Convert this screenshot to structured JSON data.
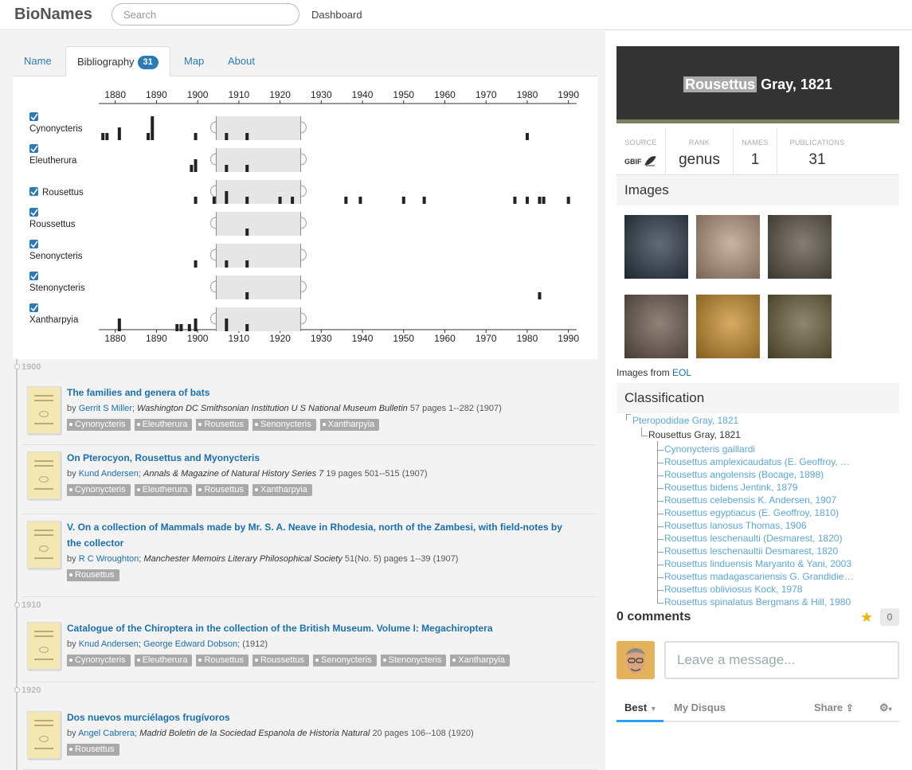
{
  "topbar": {
    "brand": "BioNames",
    "search_placeholder": "Search",
    "nav_dashboard": "Dashboard"
  },
  "tabs": [
    {
      "label": "Name"
    },
    {
      "label": "Bibliography",
      "badge": "31"
    },
    {
      "label": "Map"
    },
    {
      "label": "About"
    }
  ],
  "timeline": {
    "years": [
      "1880",
      "1890",
      "1900",
      "1910",
      "1920",
      "1930",
      "1940",
      "1950",
      "1960",
      "1970",
      "1980",
      "1990"
    ],
    "year_start": 1876,
    "year_end": 1992,
    "selection": [
      1904.5,
      1925
    ],
    "rows": [
      {
        "name": "Cynonycteris",
        "checked": true,
        "marks": [
          1877,
          1878,
          1881,
          1888,
          1889,
          1899.5,
          1907,
          1912,
          1980
        ]
      },
      {
        "name": "Eleutherura",
        "checked": true,
        "marks": [
          1898.5,
          1899.5,
          1907,
          1912
        ]
      },
      {
        "name": "Rousettus",
        "checked": true,
        "marks": [
          1899.5,
          1904,
          1907,
          1912,
          1920,
          1923,
          1936,
          1939.5,
          1950,
          1955,
          1977,
          1980,
          1983,
          1984,
          1990
        ]
      },
      {
        "name": "Roussettus",
        "checked": true,
        "marks": [
          1912
        ]
      },
      {
        "name": "Senonycteris",
        "checked": true,
        "marks": [
          1899.5,
          1907,
          1912
        ]
      },
      {
        "name": "Stenonycteris",
        "checked": true,
        "marks": [
          1912,
          1983
        ]
      },
      {
        "name": "Xantharpyia",
        "checked": true,
        "marks": [
          1881,
          1895,
          1896,
          1898,
          1899.5,
          1907,
          1912
        ]
      }
    ],
    "tall_marks": {
      "Cynonycteris": [
        1881,
        1889
      ],
      "Rousettus": [
        1907
      ],
      "Eleutherura": [
        1899.5
      ],
      "Xantharpyia": [
        1881,
        1899.5,
        1907
      ]
    }
  },
  "bibliography": {
    "decades": [
      "1900",
      "1910",
      "1920"
    ],
    "entries": [
      {
        "title": "The families and genera of bats",
        "authors": [
          "Gerrit S Miller"
        ],
        "journal": "Washington DC Smithsonian Institution U S National Museum Bulletin",
        "details": "57 pages 1--282 (1907)",
        "tags": [
          "Cynonycteris",
          "Eleutherura",
          "Rousettus",
          "Senonycteris",
          "Xantharpyia"
        ]
      },
      {
        "title": "On Pterocyon, Rousettus and Myonycteris",
        "authors": [
          "Kund Andersen"
        ],
        "journal": "Annals & Magazine of Natural History Series 7",
        "details": "19 pages 501--515 (1907)",
        "tags": [
          "Cynonycteris",
          "Eleutherura",
          "Rousettus",
          "Xantharpyia"
        ]
      },
      {
        "title": "V. On a collection of Mammals made by Mr. S. A. Neave in Rhodesia, north of the Zambesi, with field-notes by the collector",
        "authors": [
          "R C Wroughton"
        ],
        "journal": "Manchester Memoirs Literary Philosophical Society",
        "details": "51(No. 5) pages 1--39 (1907)",
        "tags": [
          "Rousettus"
        ]
      },
      {
        "title": "Catalogue of the Chiroptera in the collection of the British Museum. Volume I: Megachiroptera",
        "authors": [
          "Knud Andersen",
          "George Edward Dobson"
        ],
        "journal": "",
        "details": "(1912)",
        "tags": [
          "Cynonycteris",
          "Eleutherura",
          "Rousettus",
          "Roussettus",
          "Senonycteris",
          "Stenonycteris",
          "Xantharpyia"
        ]
      },
      {
        "title": "Dos nuevos murciélagos frugívoros",
        "authors": [
          "Angel Cabrera"
        ],
        "journal": "Madrid Boletin de la Sociedad Espanola de Historia Natural",
        "details": "20 pages 106--108 (1920)",
        "tags": [
          "Rousettus"
        ]
      }
    ]
  },
  "taxon": {
    "name_highlight": "Rousettus",
    "name_rest": " Gray, 1821",
    "stats": {
      "source_label": "SOURCE",
      "source_value": "GBIF",
      "rank_label": "RANK",
      "rank_value": "genus",
      "names_label": "NAMES",
      "names_value": "1",
      "publications_label": "PUBLICATIONS",
      "publications_value": "31"
    }
  },
  "images": {
    "heading": "Images",
    "from_text": "Images from ",
    "from_link": "EOL",
    "thumbs": [
      {
        "icon": "bat-photo-1",
        "color": "#2d3a4a"
      },
      {
        "icon": "bat-photo-2",
        "color": "#b89a82"
      },
      {
        "icon": "bat-photo-3",
        "color": "#5a5448"
      },
      {
        "icon": "bat-photo-4",
        "color": "#6c5a4e"
      },
      {
        "icon": "bat-photo-5",
        "color": "#c9902e"
      },
      {
        "icon": "bat-photo-6",
        "color": "#6a5f3c"
      }
    ]
  },
  "classification": {
    "heading": "Classification",
    "parent": "Pteropodidae Gray, 1821",
    "current": "Rousettus Gray, 1821",
    "children": [
      "Cynonycteris gaillardi",
      "Rousettus amplexicaudatus (E. Geoffroy, …",
      "Rousettus angolensis (Bocage, 1898)",
      "Rousettus bidens Jentink, 1879",
      "Rousettus celebensis K. Andersen, 1907",
      "Rousettus egyptiacus (E. Geoffroy, 1810)",
      "Rousettus lanosus Thomas, 1906",
      "Rousettus leschenaulti (Desmarest, 1820)",
      "Rousettus leschenaultii Desmarest, 1820",
      "Rousettus linduensis Maryanto & Yani, 2003",
      "Rousettus madagascariensis G. Grandidie…",
      "Rousettus obliviosus Kock, 1978",
      "Rousettus spinalatus Bergmans & Hill, 1980"
    ]
  },
  "comments": {
    "count_label": "0 comments",
    "star_count": "0",
    "placeholder": "Leave a message...",
    "tab_best": "Best",
    "tab_mydisqus": "My Disqus",
    "share": "Share"
  },
  "colors": {
    "link": "#1a6fb0",
    "accent": "#2b7bb9",
    "hero_bg": "#333333",
    "hero_stripe": "#7a8063"
  }
}
